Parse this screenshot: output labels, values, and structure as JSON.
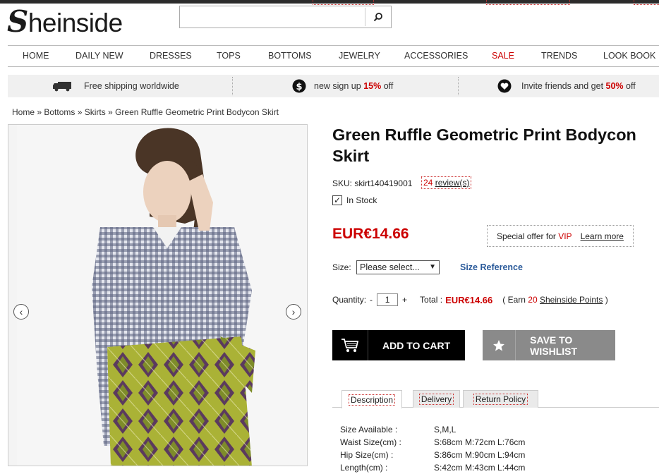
{
  "brand": {
    "logo_initial": "S",
    "logo_rest": "heinside"
  },
  "search": {
    "placeholder": ""
  },
  "nav": [
    "HOME",
    "DAILY NEW",
    "DRESSES",
    "TOPS",
    "BOTTOMS",
    "JEWELRY",
    "ACCESSORIES",
    "SALE",
    "TRENDS",
    "LOOK BOOK"
  ],
  "promo": {
    "shipping": "Free shipping worldwide",
    "signup_pre": "new sign up ",
    "signup_pct": "15%",
    "signup_post": " off",
    "invite_pre": "Invite friends and get ",
    "invite_pct": "50%",
    "invite_post": " off"
  },
  "breadcrumb": [
    "Home",
    "Bottoms",
    "Skirts",
    "Green Ruffle Geometric Print Bodycon Skirt"
  ],
  "product": {
    "title": "Green Ruffle Geometric Print Bodycon Skirt",
    "sku_label": "SKU:",
    "sku": "skirt140419001",
    "review_count": "24",
    "review_label": "review(s)",
    "stock": "In Stock",
    "price": "EUR€14.66",
    "offer_text": "Special offer for ",
    "offer_vip": "VIP",
    "learn_more": "Learn more",
    "size_label": "Size:",
    "size_selected": "Please select...",
    "size_reference": "Size Reference",
    "qty_label": "Quantity:",
    "qty_minus": "-",
    "qty_value": "1",
    "qty_plus": "+",
    "total_label": "Total :",
    "total_value": "EUR€14.66",
    "earn_pre": "( Earn ",
    "earn_points": "20",
    "earn_link": "Sheinside Points",
    "earn_post": " )",
    "add_to_cart": "ADD TO CART",
    "save_wishlist": "SAVE TO WISHLIST"
  },
  "tabs": [
    "Description",
    "Delivery",
    "Return Policy"
  ],
  "specs": [
    {
      "k": "Size Available :",
      "v": "S,M,L"
    },
    {
      "k": "Waist Size(cm) :",
      "v": "S:68cm M:72cm L:76cm"
    },
    {
      "k": "Hip Size(cm) :",
      "v": "S:86cm M:90cm L:94cm"
    },
    {
      "k": "Length(cm) :",
      "v": "S:42cm M:43cm L:44cm"
    }
  ],
  "colors": {
    "accent_red": "#cc0000",
    "link_blue": "#2a5a9a",
    "cart_bg": "#000000",
    "wishlist_bg": "#8a8a8a"
  },
  "icons": [
    "search-icon",
    "truck-icon",
    "dollar-icon",
    "heart-icon",
    "arrow-left-icon",
    "arrow-right-icon",
    "cart-icon",
    "star-icon",
    "checkbox-icon"
  ]
}
